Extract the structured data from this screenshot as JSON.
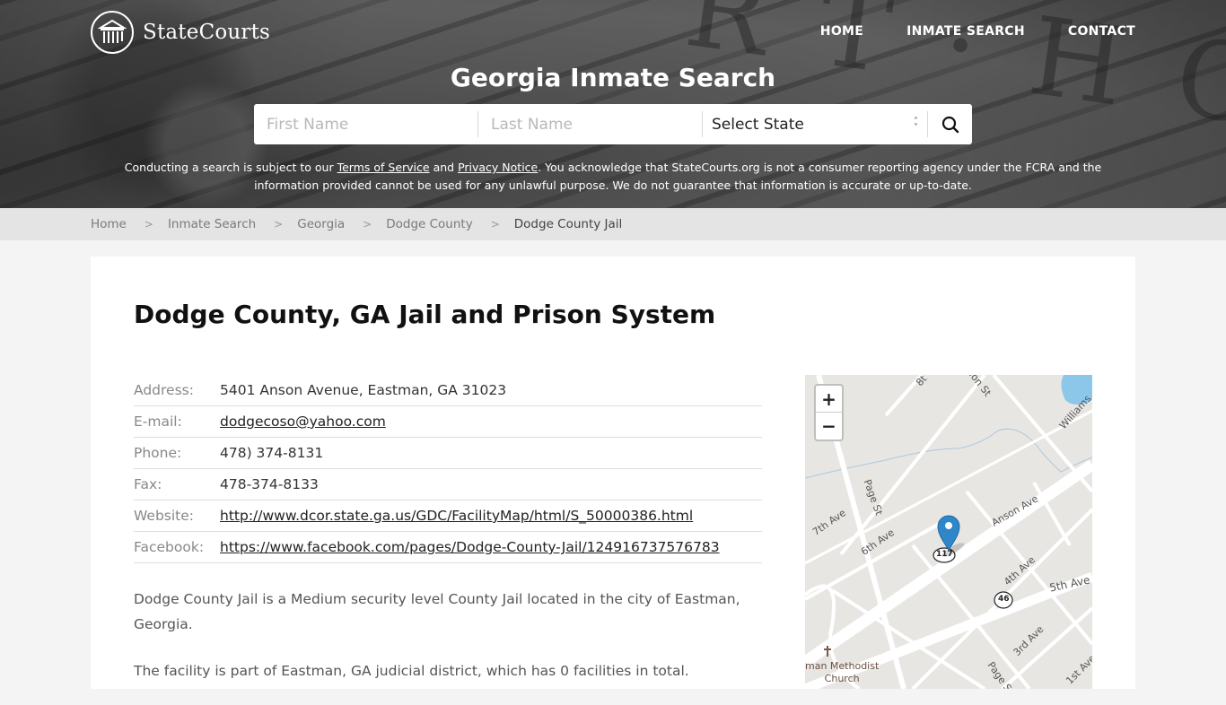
{
  "header": {
    "brand": "StateCourts",
    "nav": [
      {
        "label": "HOME"
      },
      {
        "label": "INMATE SEARCH"
      },
      {
        "label": "CONTACT"
      }
    ],
    "title": "Georgia Inmate Search"
  },
  "search": {
    "first_name_placeholder": "First Name",
    "last_name_placeholder": "Last Name",
    "state_select_value": "Select State",
    "search_icon": "search-icon"
  },
  "disclaimer": {
    "prefix": "Conducting a search is subject to our ",
    "terms_link": "Terms of Service",
    "and": " and ",
    "privacy_link": "Privacy Notice",
    "suffix": ". You acknowledge that StateCourts.org is not a consumer reporting agency under the FCRA and the information provided cannot be used for any unlawful purpose. We do not guarantee that information is accurate or up-to-date."
  },
  "breadcrumb": [
    {
      "label": "Home"
    },
    {
      "label": "Inmate Search"
    },
    {
      "label": "Georgia"
    },
    {
      "label": "Dodge County"
    },
    {
      "label": "Dodge County Jail"
    }
  ],
  "main": {
    "title": "Dodge County, GA Jail and Prison System",
    "details": {
      "address_label": "Address:",
      "address": "5401 Anson Avenue, Eastman, GA 31023",
      "email_label": "E-mail:",
      "email": "dodgecoso@yahoo.com",
      "phone_label": "Phone:",
      "phone": "478) 374-8131",
      "fax_label": "Fax:",
      "fax": "478-374-8133",
      "website_label": "Website:",
      "website": "http://www.dcor.state.ga.us/GDC/FacilityMap/html/S_50000386.html",
      "facebook_label": "Facebook:",
      "facebook": "https://www.facebook.com/pages/Dodge-County-Jail/124916737576783"
    },
    "description": [
      "Dodge County Jail is a Medium security level County Jail located in the city of Eastman, Georgia.",
      "The facility is part of Eastman, GA judicial district, which has 0 facilities in total."
    ]
  },
  "map": {
    "zoom_in": "+",
    "zoom_out": "−",
    "labels": {
      "page_st": "Page St",
      "page_st_2": "Page S",
      "seventh_ave": "7th Ave",
      "sixth_ave": "6th Ave",
      "anson_ave": "Anson Ave",
      "fourth_ave": "4th Ave",
      "fifth_ave": "5th Ave",
      "third_ave": "3rd Ave",
      "first_ave": "1st Ave",
      "williams": "Williams",
      "eighth": "8t",
      "don_st": "don St",
      "route_117": "117",
      "route_46": "46",
      "church": "man Methodist\nChurch"
    }
  }
}
